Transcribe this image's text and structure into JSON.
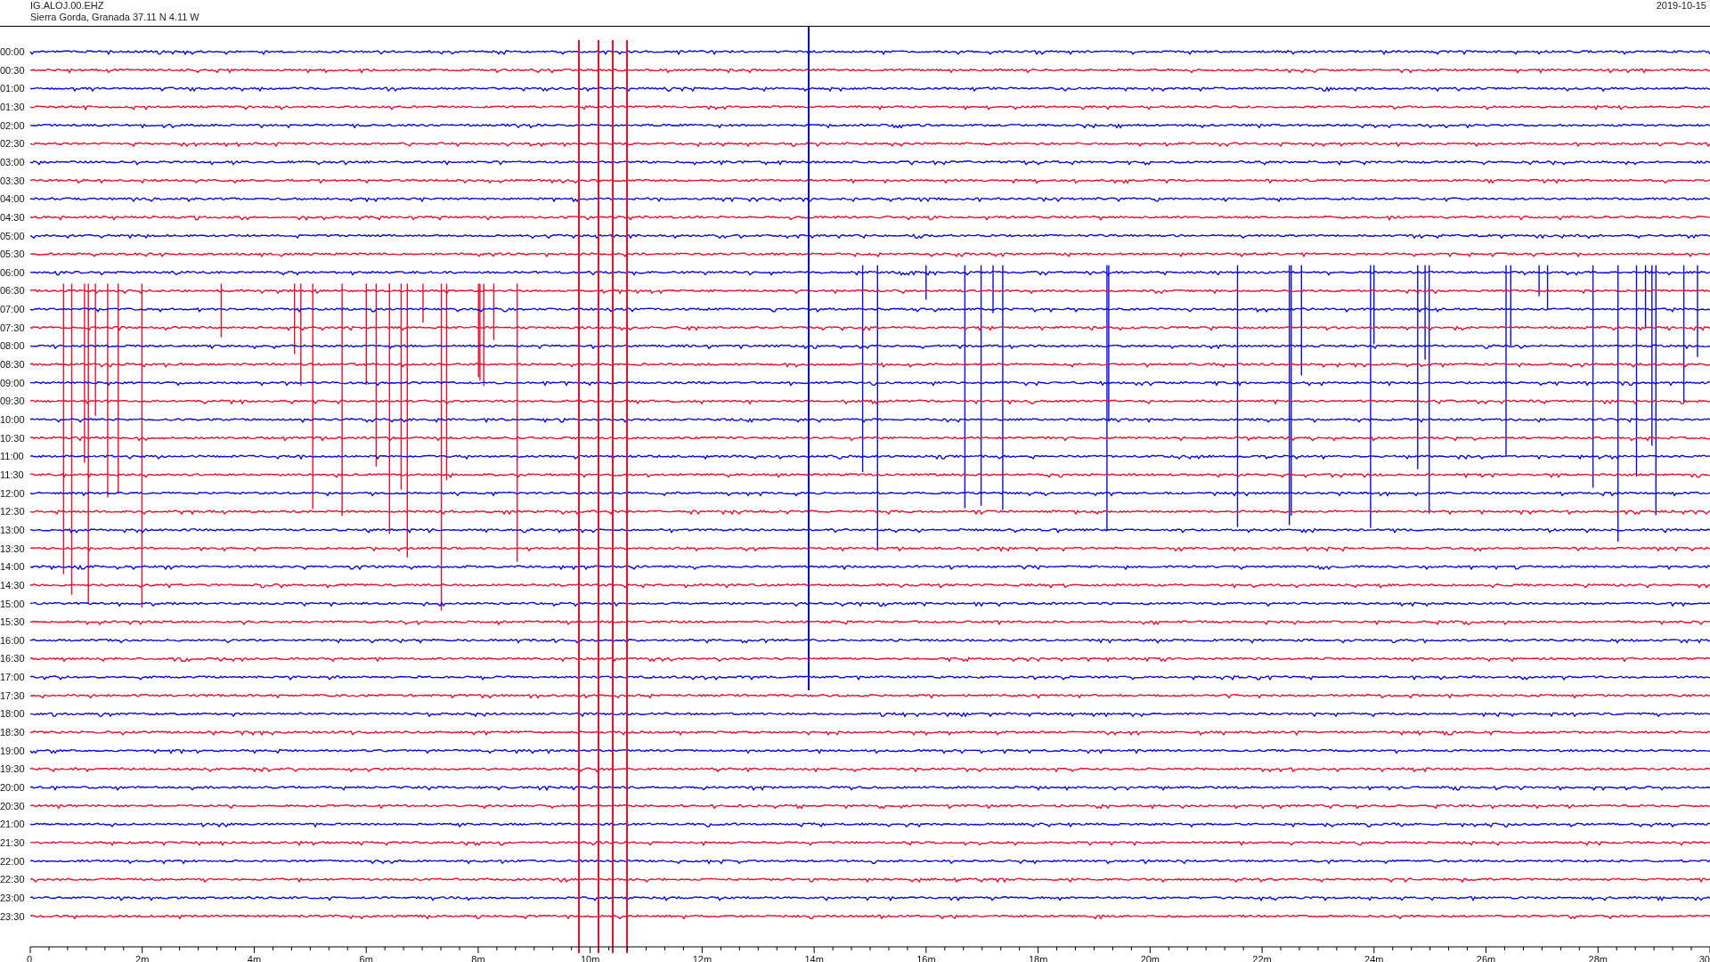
{
  "header": {
    "station": "IG.ALOJ.00.EHZ",
    "location": "Sierra Gorda, Granada  37.11 N 4.11 W",
    "date": "2019-10-15"
  },
  "rows": [
    {
      "label": "00:00",
      "color": "#0a0adc"
    },
    {
      "label": "00:30",
      "color": "#e8102e"
    },
    {
      "label": "01:00",
      "color": "#0a0adc"
    },
    {
      "label": "01:30",
      "color": "#e8102e"
    },
    {
      "label": "02:00",
      "color": "#0a0adc"
    },
    {
      "label": "02:30",
      "color": "#e8102e"
    },
    {
      "label": "03:00",
      "color": "#0a0adc"
    },
    {
      "label": "03:30",
      "color": "#e8102e"
    },
    {
      "label": "04:00",
      "color": "#0a0adc"
    },
    {
      "label": "04:30",
      "color": "#e8102e"
    },
    {
      "label": "05:00",
      "color": "#0a0adc"
    },
    {
      "label": "05:30",
      "color": "#e8102e"
    },
    {
      "label": "06:00",
      "color": "#0a0adc"
    },
    {
      "label": "06:30",
      "color": "#e8102e"
    },
    {
      "label": "07:00",
      "color": "#0a0adc"
    },
    {
      "label": "07:30",
      "color": "#e8102e"
    },
    {
      "label": "08:00",
      "color": "#0a0adc"
    },
    {
      "label": "08:30",
      "color": "#e8102e"
    },
    {
      "label": "09:00",
      "color": "#0a0adc"
    },
    {
      "label": "09:30",
      "color": "#e8102e"
    },
    {
      "label": "10:00",
      "color": "#0a0adc"
    },
    {
      "label": "10:30",
      "color": "#e8102e"
    },
    {
      "label": "11:00",
      "color": "#0a0adc"
    },
    {
      "label": "11:30",
      "color": "#e8102e"
    },
    {
      "label": "12:00",
      "color": "#0a0adc"
    },
    {
      "label": "12:30",
      "color": "#e8102e"
    },
    {
      "label": "13:00",
      "color": "#0a0adc"
    },
    {
      "label": "13:30",
      "color": "#e8102e"
    },
    {
      "label": "14:00",
      "color": "#0a0adc"
    },
    {
      "label": "14:30",
      "color": "#e8102e"
    },
    {
      "label": "15:00",
      "color": "#0a0adc"
    },
    {
      "label": "15:30",
      "color": "#e8102e"
    },
    {
      "label": "16:00",
      "color": "#0a0adc"
    },
    {
      "label": "16:30",
      "color": "#e8102e"
    },
    {
      "label": "17:00",
      "color": "#0a0adc"
    },
    {
      "label": "17:30",
      "color": "#e8102e"
    },
    {
      "label": "18:00",
      "color": "#0a0adc"
    },
    {
      "label": "18:30",
      "color": "#e8102e"
    },
    {
      "label": "19:00",
      "color": "#0a0adc"
    },
    {
      "label": "19:30",
      "color": "#e8102e"
    },
    {
      "label": "20:00",
      "color": "#0a0adc"
    },
    {
      "label": "20:30",
      "color": "#e8102e"
    },
    {
      "label": "21:00",
      "color": "#0a0adc"
    },
    {
      "label": "21:30",
      "color": "#e8102e"
    },
    {
      "label": "22:00",
      "color": "#0a0adc"
    },
    {
      "label": "22:30",
      "color": "#e8102e"
    },
    {
      "label": "23:00",
      "color": "#0a0adc"
    },
    {
      "label": "23:30",
      "color": "#e8102e"
    }
  ],
  "x_axis": {
    "ticks": [
      "0",
      "2m",
      "4m",
      "6m",
      "8m",
      "10m",
      "12m",
      "14m",
      "16m",
      "18m",
      "20m",
      "22m",
      "24m",
      "26m",
      "28m",
      "30"
    ]
  }
}
